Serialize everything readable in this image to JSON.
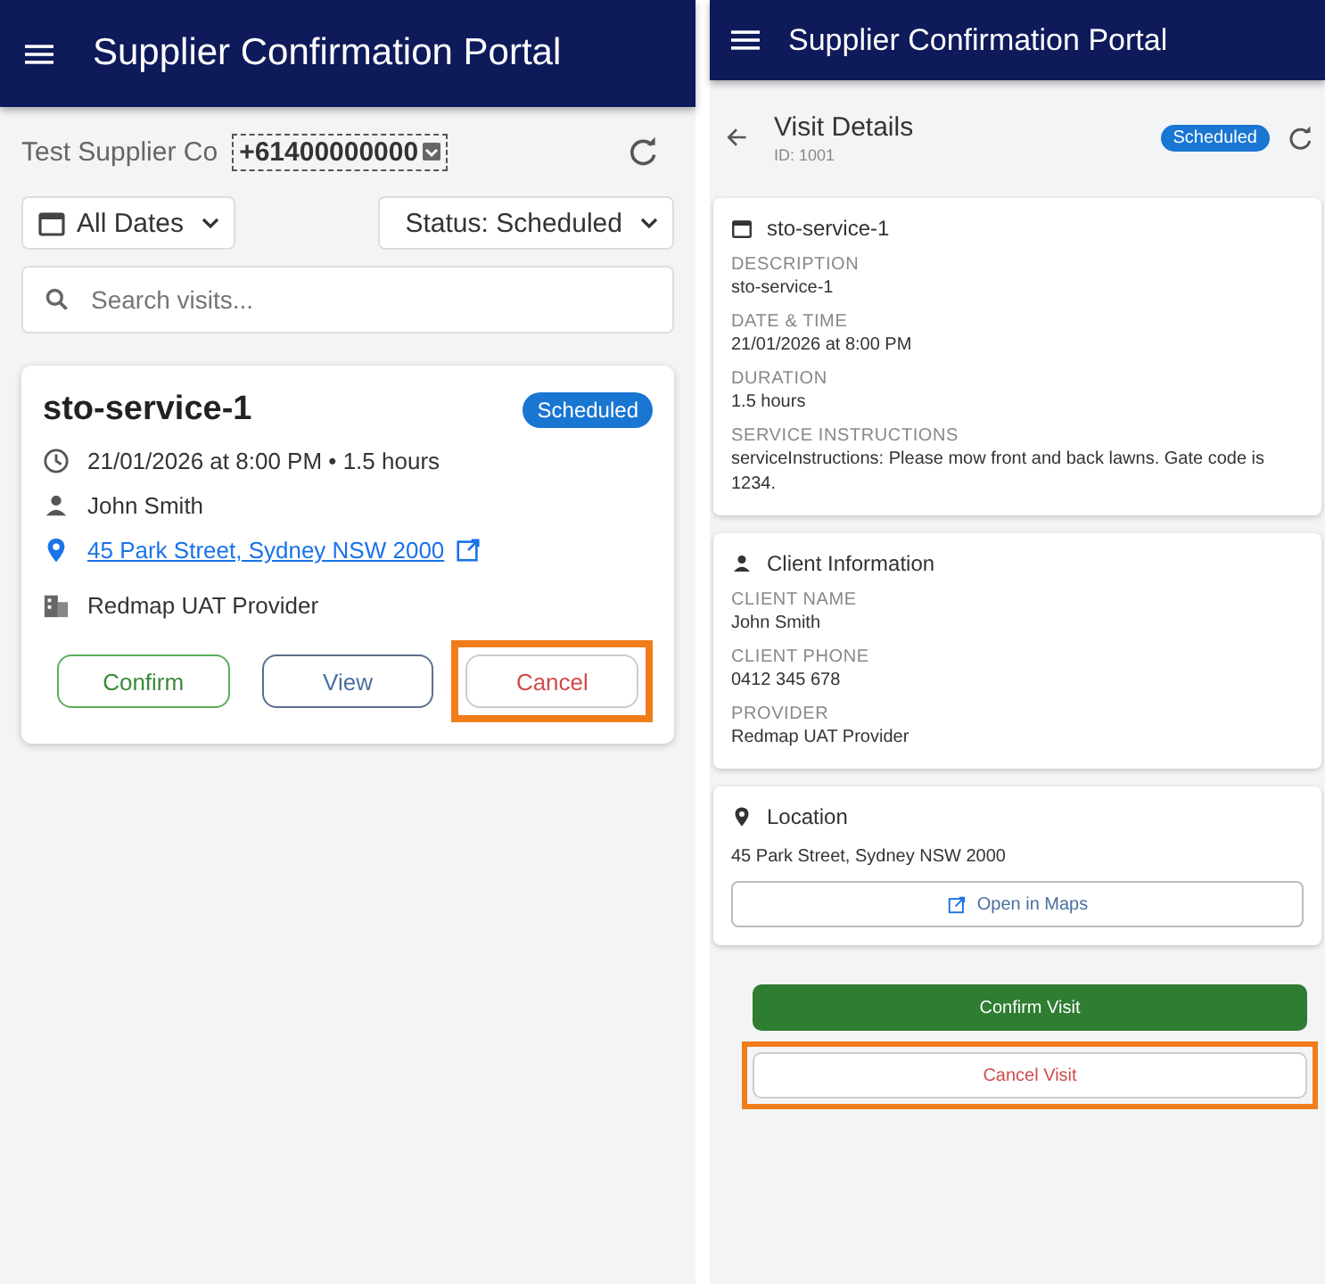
{
  "screens": [
    {
      "kind": "list",
      "header": {
        "title": "Supplier Confirmation Portal"
      },
      "supplier": {
        "name": "Test Supplier Co",
        "phone": "+61400000000"
      },
      "filters": [
        {
          "label": "All Dates",
          "kind": "date"
        },
        {
          "label": "Status: Scheduled",
          "kind": "status"
        }
      ],
      "search": {
        "placeholder": "Search visits..."
      },
      "visit": {
        "title": "sto-service-1",
        "status": "Scheduled",
        "when": "21/01/2026 at 8:00 PM • 1.5 hours",
        "client": "John Smith",
        "address": "45 Park Street, Sydney NSW 2000",
        "provider": "Redmap UAT Provider",
        "buttons": [
          {
            "label": "Confirm",
            "kind": "confirm",
            "highlighted": false
          },
          {
            "label": "View",
            "kind": "view",
            "highlighted": false
          },
          {
            "label": "Cancel",
            "kind": "cancel",
            "highlighted": true
          }
        ]
      }
    },
    {
      "kind": "detail",
      "header": {
        "title": "Supplier Confirmation Portal"
      },
      "page_title": "Visit Details",
      "id": "ID: 1001",
      "status": "Scheduled",
      "sections": [
        {
          "kind": "calendar",
          "title": "sto-service-1",
          "fields": [
            {
              "label": "DESCRIPTION",
              "value": "sto-service-1"
            },
            {
              "label": "DATE & TIME",
              "value": "21/01/2026 at 8:00 PM"
            },
            {
              "label": "DURATION",
              "value": "1.5 hours"
            },
            {
              "label": "SERVICE INSTRUCTIONS",
              "value": "serviceInstructions: Please mow front and back lawns. Gate code is 1234."
            }
          ]
        },
        {
          "kind": "person",
          "title": "Client Information",
          "fields": [
            {
              "label": "CLIENT NAME",
              "value": "John Smith"
            },
            {
              "label": "CLIENT PHONE",
              "value": "0412 345 678"
            },
            {
              "label": "PROVIDER",
              "value": "Redmap UAT Provider"
            }
          ]
        },
        {
          "kind": "location",
          "title": "Location",
          "address": "45 Park Street, Sydney NSW 2000",
          "button": "Open in Maps"
        }
      ],
      "actions": [
        {
          "label": "Confirm Visit",
          "kind": "confirm",
          "highlighted": false
        },
        {
          "label": "Cancel Visit",
          "kind": "cancel",
          "highlighted": true
        }
      ]
    }
  ]
}
